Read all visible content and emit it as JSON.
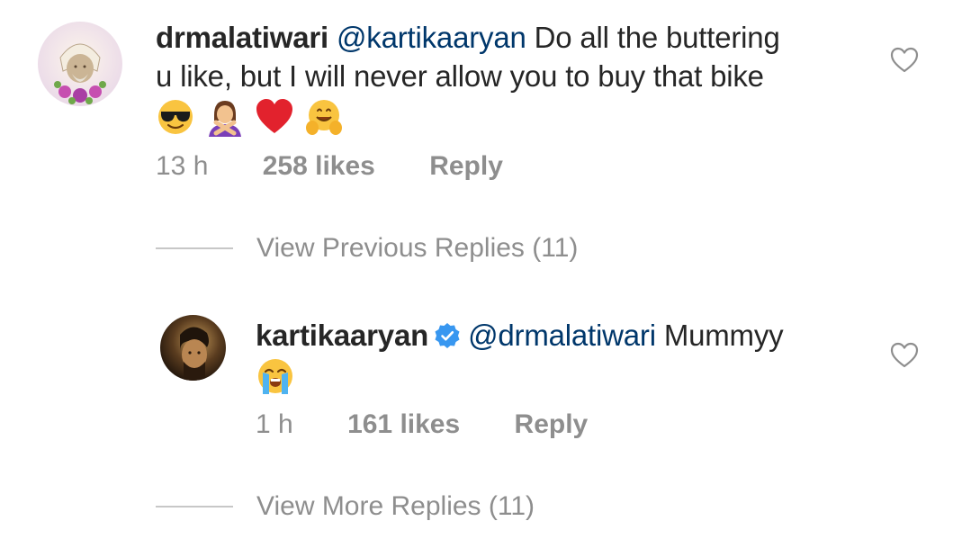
{
  "comments": [
    {
      "username": "drmalatiwari",
      "mention": "@kartikaaryan",
      "text_line1": " Do all the buttering",
      "text_line2": "u like, but I will never allow you to buy that bike",
      "emojis": [
        "smiling-face-with-sunglasses",
        "person-gesturing-no",
        "red-heart",
        "hugging-face"
      ],
      "time": "13 h",
      "likes": "258 likes",
      "reply_label": "Reply"
    },
    {
      "username": "kartikaaryan",
      "verified": true,
      "mention": "@drmalatiwari",
      "text": " Mummyy",
      "emojis": [
        "loudly-crying-face"
      ],
      "time": "1 h",
      "likes": "161 likes",
      "reply_label": "Reply"
    }
  ],
  "view_previous_replies": "View Previous Replies (11)",
  "view_more_replies": "View More Replies (11)",
  "colors": {
    "text": "#262626",
    "mention": "#00376b",
    "meta": "#8e8e8e",
    "divider": "#c7c7c7",
    "verified": "#3897f0"
  }
}
